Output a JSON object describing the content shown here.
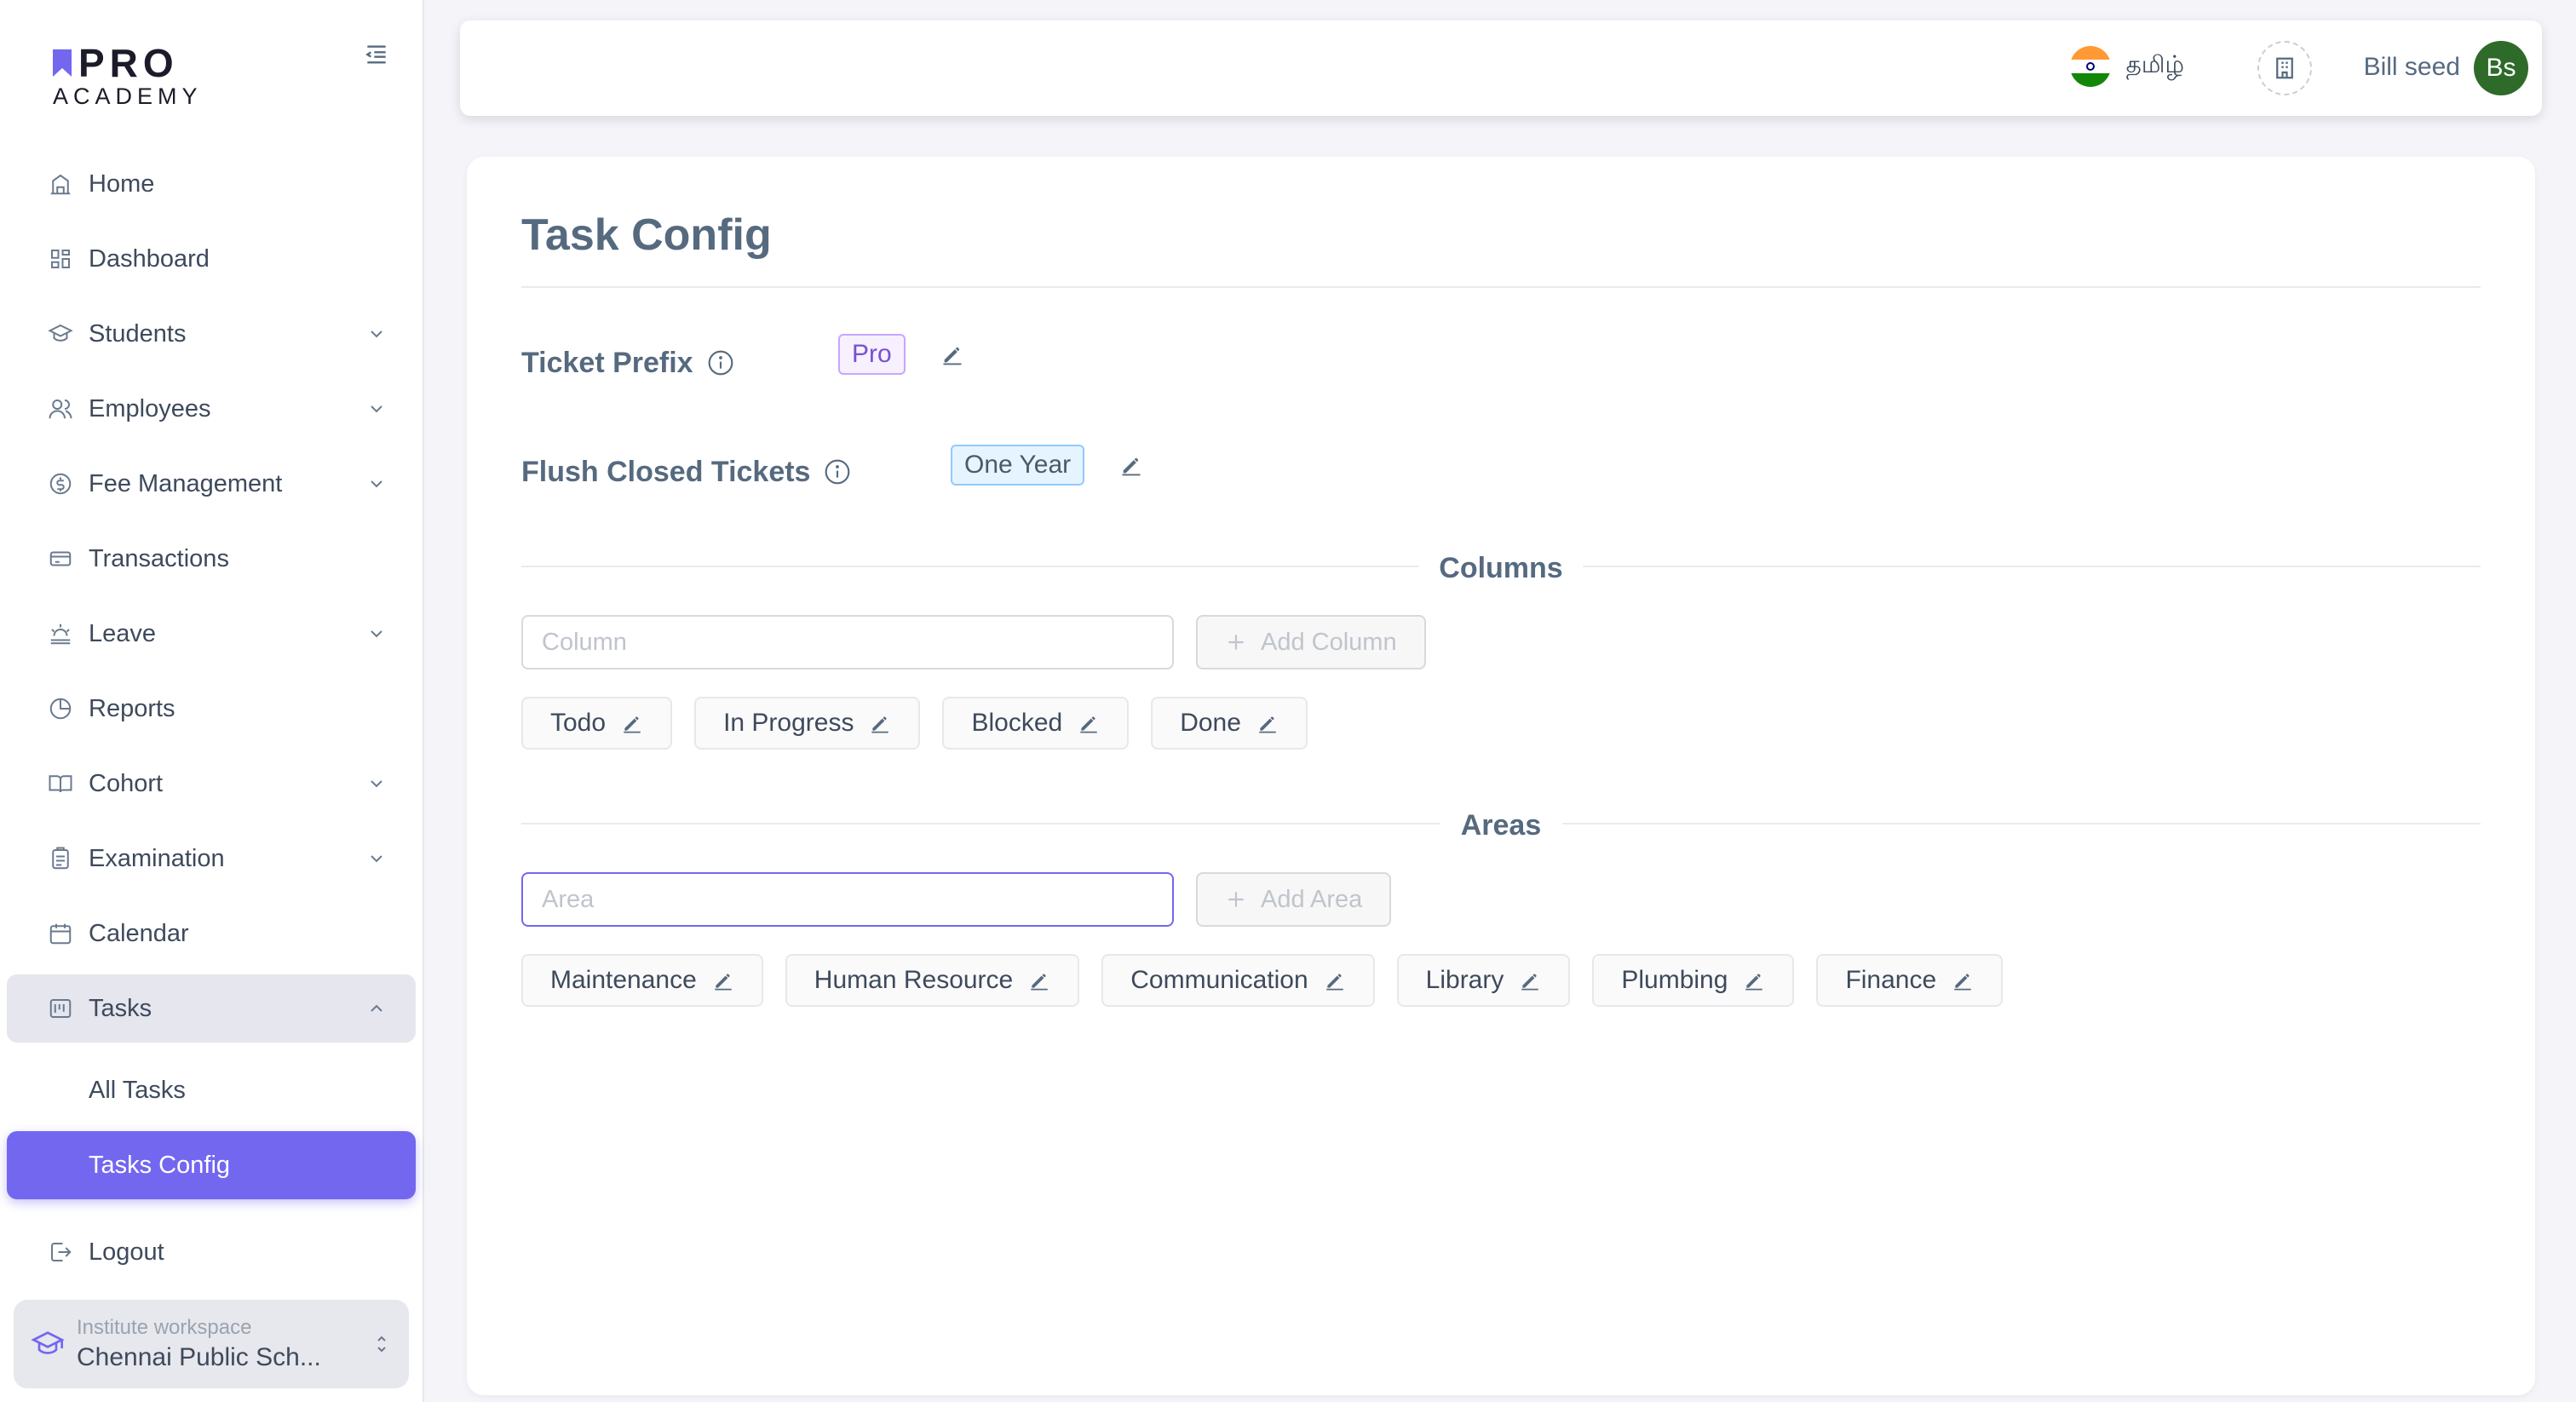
{
  "brand": {
    "top": "PRO",
    "bottom": "ACADEMY"
  },
  "sidebar": {
    "items": [
      {
        "label": "Home",
        "icon": "home-icon",
        "has_children": false
      },
      {
        "label": "Dashboard",
        "icon": "dashboard-icon",
        "has_children": false
      },
      {
        "label": "Students",
        "icon": "students-icon",
        "has_children": true
      },
      {
        "label": "Employees",
        "icon": "employees-icon",
        "has_children": true
      },
      {
        "label": "Fee Management",
        "icon": "fee-icon",
        "has_children": true
      },
      {
        "label": "Transactions",
        "icon": "transactions-icon",
        "has_children": false
      },
      {
        "label": "Leave",
        "icon": "leave-icon",
        "has_children": true
      },
      {
        "label": "Reports",
        "icon": "reports-icon",
        "has_children": false
      },
      {
        "label": "Cohort",
        "icon": "cohort-icon",
        "has_children": true
      },
      {
        "label": "Examination",
        "icon": "examination-icon",
        "has_children": true
      },
      {
        "label": "Calendar",
        "icon": "calendar-icon",
        "has_children": false
      },
      {
        "label": "Tasks",
        "icon": "tasks-icon",
        "has_children": true,
        "expanded": true
      }
    ],
    "tasks_children": [
      {
        "label": "All Tasks"
      },
      {
        "label": "Tasks Config",
        "active": true
      }
    ],
    "logout_label": "Logout",
    "workspace": {
      "label": "Institute workspace",
      "value": "Chennai Public Sch..."
    }
  },
  "topbar": {
    "language": "தமிழ்",
    "user_name": "Bill seed",
    "avatar_initials": "Bs",
    "avatar_color": "#2e6b2a"
  },
  "page": {
    "title": "Task Config",
    "ticket_prefix": {
      "label": "Ticket Prefix",
      "value": "Pro"
    },
    "flush_closed": {
      "label": "Flush Closed Tickets",
      "value": "One Year"
    },
    "columns": {
      "title": "Columns",
      "input_placeholder": "Column",
      "add_label": "Add Column",
      "items": [
        "Todo",
        "In Progress",
        "Blocked",
        "Done"
      ]
    },
    "areas": {
      "title": "Areas",
      "input_placeholder": "Area",
      "add_label": "Add Area",
      "items": [
        "Maintenance",
        "Human Resource",
        "Communication",
        "Library",
        "Plumbing",
        "Finance"
      ]
    }
  },
  "colors": {
    "accent": "#7367f0",
    "text": "#566a7f",
    "background": "#f5f5f9"
  }
}
